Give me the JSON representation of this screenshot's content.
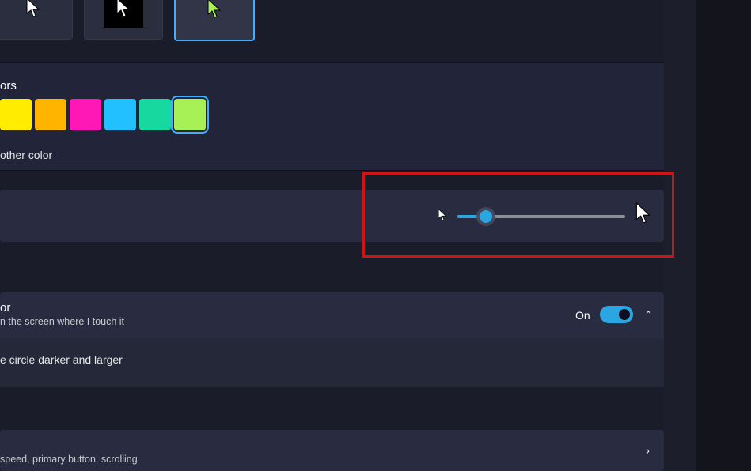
{
  "pointer_styles": {
    "tiles": [
      {
        "id": "white-cursor",
        "selected": false
      },
      {
        "id": "invert-cursor",
        "selected": false
      },
      {
        "id": "color-cursor",
        "selected": true
      }
    ]
  },
  "colors_section": {
    "label": "ors",
    "other_color_label": "other color",
    "swatches": [
      {
        "hex": "#ffec00",
        "selected": false
      },
      {
        "hex": "#ffb400",
        "selected": false
      },
      {
        "hex": "#ff18b6",
        "selected": false
      },
      {
        "hex": "#23c0ff",
        "selected": false
      },
      {
        "hex": "#17d9a0",
        "selected": false
      },
      {
        "hex": "#a7f056",
        "selected": true
      }
    ]
  },
  "pointer_size": {
    "min_icon": "cursor-small",
    "max_icon": "cursor-large",
    "value_percent": 17
  },
  "touch_indicator": {
    "title": "or",
    "subtitle": "n the screen where I touch it",
    "toggle_state_label": "On",
    "toggle_on": true,
    "sub_option": "e circle darker and larger"
  },
  "mouse_row": {
    "subtitle": "speed, primary button, scrolling"
  },
  "highlight_box": true
}
